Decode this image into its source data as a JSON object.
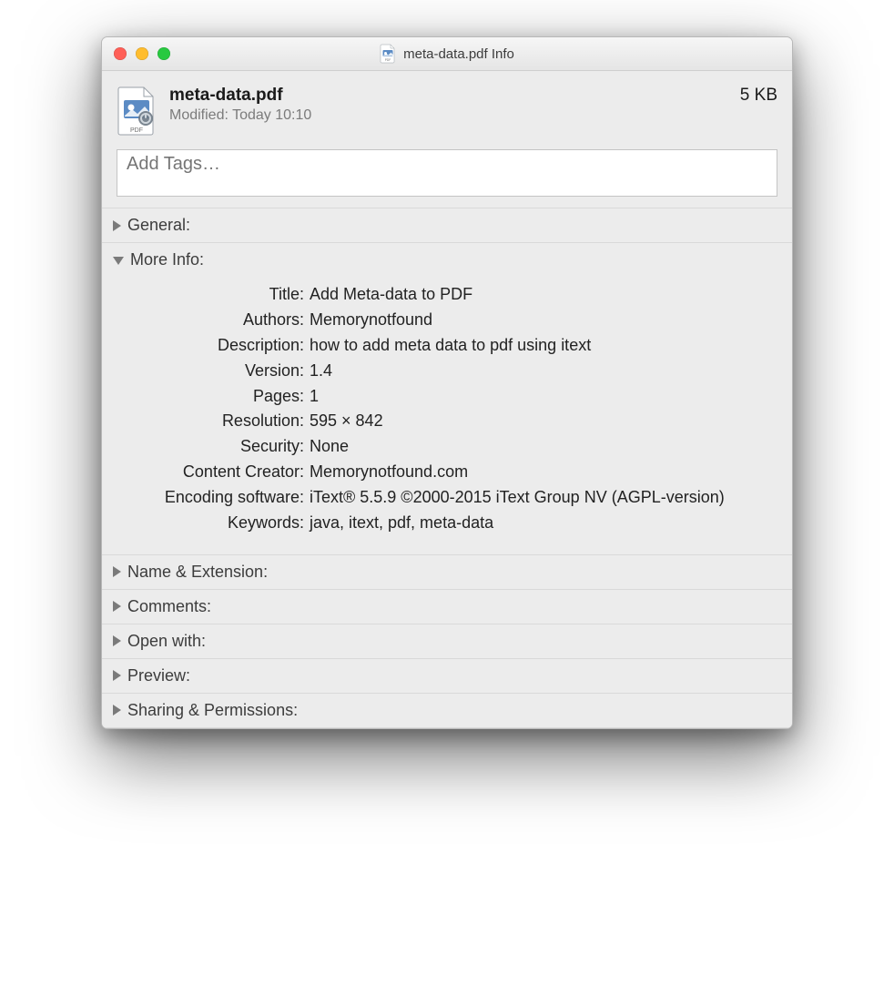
{
  "window": {
    "title": "meta-data.pdf Info"
  },
  "header": {
    "filename": "meta-data.pdf",
    "modified": "Modified: Today 10:10",
    "size": "5 KB"
  },
  "tags": {
    "placeholder": "Add Tags…"
  },
  "sections": {
    "general": {
      "label": "General:"
    },
    "more_info": {
      "label": "More Info:"
    },
    "name_ext": {
      "label": "Name & Extension:"
    },
    "comments": {
      "label": "Comments:"
    },
    "open_with": {
      "label": "Open with:"
    },
    "preview": {
      "label": "Preview:"
    },
    "sharing": {
      "label": "Sharing & Permissions:"
    }
  },
  "more_info": {
    "rows": [
      {
        "label": "Title:",
        "value": "Add Meta-data to PDF"
      },
      {
        "label": "Authors:",
        "value": "Memorynotfound"
      },
      {
        "label": "Description:",
        "value": "how to add meta data to pdf using itext"
      },
      {
        "label": "Version:",
        "value": "1.4"
      },
      {
        "label": "Pages:",
        "value": "1"
      },
      {
        "label": "Resolution:",
        "value": "595 × 842"
      },
      {
        "label": "Security:",
        "value": "None"
      },
      {
        "label": "Content Creator:",
        "value": "Memorynotfound.com"
      },
      {
        "label": "Encoding software:",
        "value": "iText® 5.5.9 ©2000-2015 iText Group NV (AGPL-version)"
      },
      {
        "label": "Keywords:",
        "value": "java, itext, pdf, meta-data"
      }
    ]
  }
}
